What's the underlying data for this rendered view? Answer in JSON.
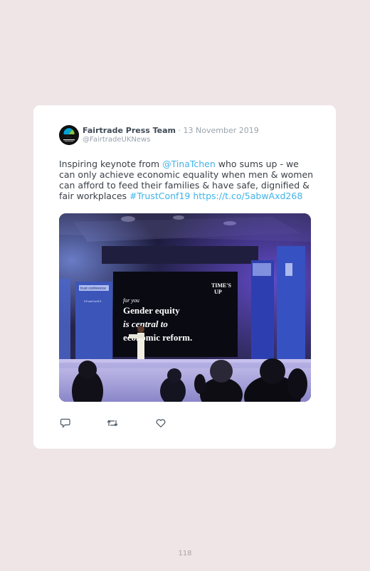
{
  "tweet": {
    "author_name": "Fairtrade Press Team",
    "separator": " · ",
    "date": "13 November 2019",
    "handle": "@FairtradeUKNews",
    "text_1": "Inspiring keynote from ",
    "mention": "@TinaTchen",
    "text_2": " who sums up - we can only achieve economic equality when men & women can afford to feed their families & have safe, dignified & fair workplaces ",
    "hashtag": "#TrustConf19",
    "space": " ",
    "url": "https://t.co/5abwAxd268"
  },
  "photo": {
    "screen_line_1": "for you",
    "screen_line_2": "Gender equity",
    "screen_line_3": "is central to",
    "screen_line_4": "economic reform.",
    "logo_line_1": "TIME'S",
    "logo_line_2": "UP",
    "banner_title": "trust conference",
    "banner_subtitle": "#TrustConf19"
  },
  "actions": {
    "reply_icon": "reply-icon",
    "retweet_icon": "retweet-icon",
    "like_icon": "heart-icon"
  },
  "page": {
    "number": "118"
  },
  "colors": {
    "background": "#efe5e7",
    "card": "#ffffff",
    "link": "#3fb3e8",
    "name": "#3f4a56",
    "muted": "#9aa3ad"
  }
}
